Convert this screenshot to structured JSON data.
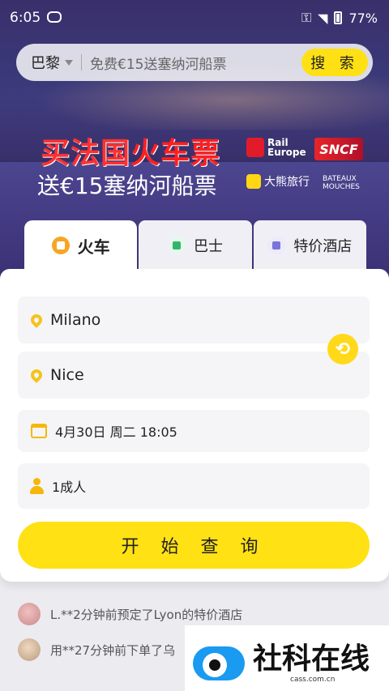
{
  "status": {
    "time": "6:05",
    "battery": "77%"
  },
  "search": {
    "city": "巴黎",
    "promo": "免费€15送塞纳河船票",
    "button": "搜 索"
  },
  "banner": {
    "line1_a": "买法国",
    "line1_b": "火车票",
    "line2": "送€15塞纳河船票",
    "rail_logo": "Rail Europe",
    "sncf": "SNCF",
    "bear": "大熊旅行",
    "bateaux": "BATEAUX MOUCHES"
  },
  "tabs": [
    {
      "label": "火车",
      "icon": "train-icon"
    },
    {
      "label": "巴士",
      "icon": "bus-icon"
    },
    {
      "label": "特价酒店",
      "icon": "hotel-icon"
    }
  ],
  "form": {
    "from": "Milano",
    "to": "Nice",
    "datetime": "4月30日 周二 18:05",
    "passengers": "1成人",
    "submit": "开 始 查 询"
  },
  "feed": [
    {
      "text": "L.**2分钟前预定了Lyon的特价酒店"
    },
    {
      "text": "用**27分钟前下单了乌"
    }
  ],
  "watermark": {
    "title": "社科在线",
    "url": "cass.com.cn"
  }
}
